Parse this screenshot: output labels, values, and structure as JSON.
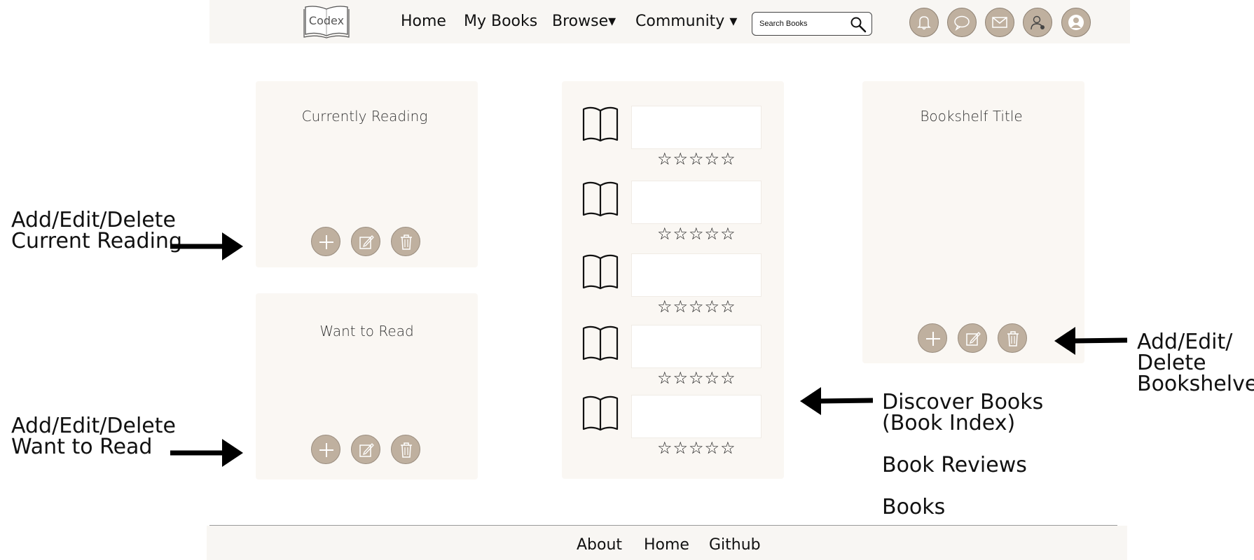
{
  "header": {
    "logo_text": "Codex",
    "nav": [
      {
        "label": "Home"
      },
      {
        "label": "My Books"
      },
      {
        "label": "Browse▾"
      },
      {
        "label": "Community ▾"
      }
    ],
    "search": {
      "placeholder": "Search Books",
      "icon": "search-icon"
    },
    "icons": [
      "bell-icon",
      "chat-icon",
      "mail-icon",
      "add-friend-icon",
      "profile-icon"
    ]
  },
  "panels": {
    "currently_reading": {
      "title": "Currently Reading"
    },
    "want_to_read": {
      "title": "Want to Read"
    },
    "bookshelf": {
      "title": "Bookshelf Title"
    }
  },
  "book_index": {
    "rows": [
      {
        "stars": "☆☆☆☆☆"
      },
      {
        "stars": "☆☆☆☆☆"
      },
      {
        "stars": "☆☆☆☆☆"
      },
      {
        "stars": "☆☆☆☆☆"
      },
      {
        "stars": "☆☆☆☆☆"
      }
    ]
  },
  "annotations": {
    "current_reading": {
      "line1": "Add/Edit/Delete",
      "line2": "Current Reading"
    },
    "want_to_read": {
      "line1": "Add/Edit/Delete",
      "line2": "Want to Read"
    },
    "bookshelves": {
      "line1": "Add/Edit/",
      "line2": "Delete",
      "line3": "Bookshelves"
    },
    "discover": {
      "line1": "Discover Books",
      "line2": "(Book Index)",
      "line3": "Book Reviews",
      "line4": "Books"
    }
  },
  "footer": {
    "links": [
      {
        "label": "About"
      },
      {
        "label": "Home"
      },
      {
        "label": "Github"
      }
    ]
  },
  "colors": {
    "header_bg": "#f8f6f3",
    "panel_bg": "#faf7f3",
    "icon_bg": "#bfb09f"
  }
}
